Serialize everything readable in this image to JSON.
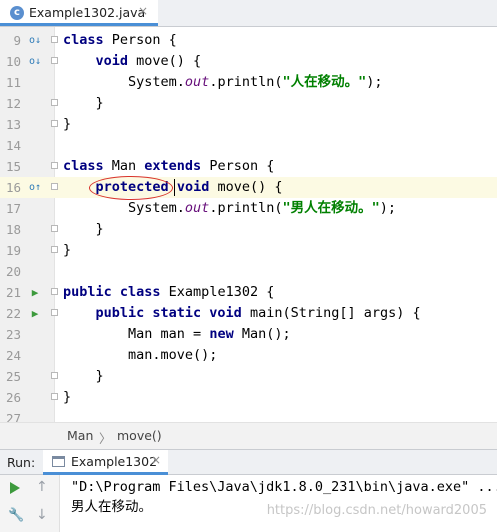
{
  "editor_tab": {
    "file_name": "Example1302.java",
    "close": "×",
    "icon": "java-class-icon"
  },
  "code_lines": [
    {
      "num": "9",
      "parts": [
        [
          "kw",
          "class"
        ],
        [
          "p",
          " Person {"
        ]
      ],
      "gutter": "implemented-override-icon",
      "fold": true
    },
    {
      "num": "10",
      "parts": [
        [
          "p",
          "    "
        ],
        [
          "kw",
          "void"
        ],
        [
          "p",
          " move() {"
        ]
      ],
      "gutter": "implemented-override-icon",
      "fold": true
    },
    {
      "num": "11",
      "parts": [
        [
          "p",
          "        System."
        ],
        [
          "fld",
          "out"
        ],
        [
          "p",
          ".println("
        ],
        [
          "str",
          "\"人在移动。\""
        ],
        [
          "p",
          ");"
        ]
      ]
    },
    {
      "num": "12",
      "parts": [
        [
          "p",
          "    }"
        ]
      ],
      "fold": true
    },
    {
      "num": "13",
      "parts": [
        [
          "p",
          "}"
        ]
      ],
      "fold": true
    },
    {
      "num": "14",
      "parts": []
    },
    {
      "num": "15",
      "parts": [
        [
          "kw",
          "class"
        ],
        [
          "p",
          " Man "
        ],
        [
          "kw",
          "extends"
        ],
        [
          "p",
          " Person {"
        ]
      ],
      "fold": true
    },
    {
      "num": "16",
      "parts": [
        [
          "p",
          "    "
        ],
        [
          "kw",
          "protected"
        ],
        [
          "p",
          " "
        ],
        [
          "kw",
          "void"
        ],
        [
          "p",
          " move() {"
        ]
      ],
      "gutter": "overrides-icon",
      "fold": true,
      "highlight": true
    },
    {
      "num": "17",
      "parts": [
        [
          "p",
          "        System."
        ],
        [
          "fld",
          "out"
        ],
        [
          "p",
          ".println("
        ],
        [
          "str",
          "\"男人在移动。\""
        ],
        [
          "p",
          ");"
        ]
      ]
    },
    {
      "num": "18",
      "parts": [
        [
          "p",
          "    }"
        ]
      ],
      "fold": true
    },
    {
      "num": "19",
      "parts": [
        [
          "p",
          "}"
        ]
      ],
      "fold": true
    },
    {
      "num": "20",
      "parts": []
    },
    {
      "num": "21",
      "parts": [
        [
          "kw",
          "public class"
        ],
        [
          "p",
          " Example1302 {"
        ]
      ],
      "gutter": "run-icon",
      "fold": true
    },
    {
      "num": "22",
      "parts": [
        [
          "p",
          "    "
        ],
        [
          "kw",
          "public static void"
        ],
        [
          "p",
          " main(String[] args) {"
        ]
      ],
      "gutter": "run-icon",
      "fold": true
    },
    {
      "num": "23",
      "parts": [
        [
          "p",
          "        Man man = "
        ],
        [
          "kw",
          "new"
        ],
        [
          "p",
          " Man();"
        ]
      ]
    },
    {
      "num": "24",
      "parts": [
        [
          "p",
          "        man.move();"
        ]
      ]
    },
    {
      "num": "25",
      "parts": [
        [
          "p",
          "    }"
        ]
      ],
      "fold": true
    },
    {
      "num": "26",
      "parts": [
        [
          "p",
          "}"
        ]
      ],
      "fold": true
    },
    {
      "num": "27",
      "parts": []
    }
  ],
  "breadcrumb": {
    "class_name": "Man",
    "separator": "〉",
    "method": "move()"
  },
  "run_panel": {
    "label": "Run:",
    "tab_name": "Example1302",
    "close": "×",
    "tab_icon": "console-icon"
  },
  "console": {
    "command": "\"D:\\Program Files\\Java\\jdk1.8.0_231\\bin\\java.exe\" ...",
    "output": "男人在移动。",
    "watermark": "https://blog.csdn.net/howard2005"
  },
  "colors": {
    "keyword": "#000080",
    "field": "#660e7a",
    "string": "#008000",
    "annotation_circle": "#d8332b",
    "line_highlight": "#fcfae3"
  }
}
